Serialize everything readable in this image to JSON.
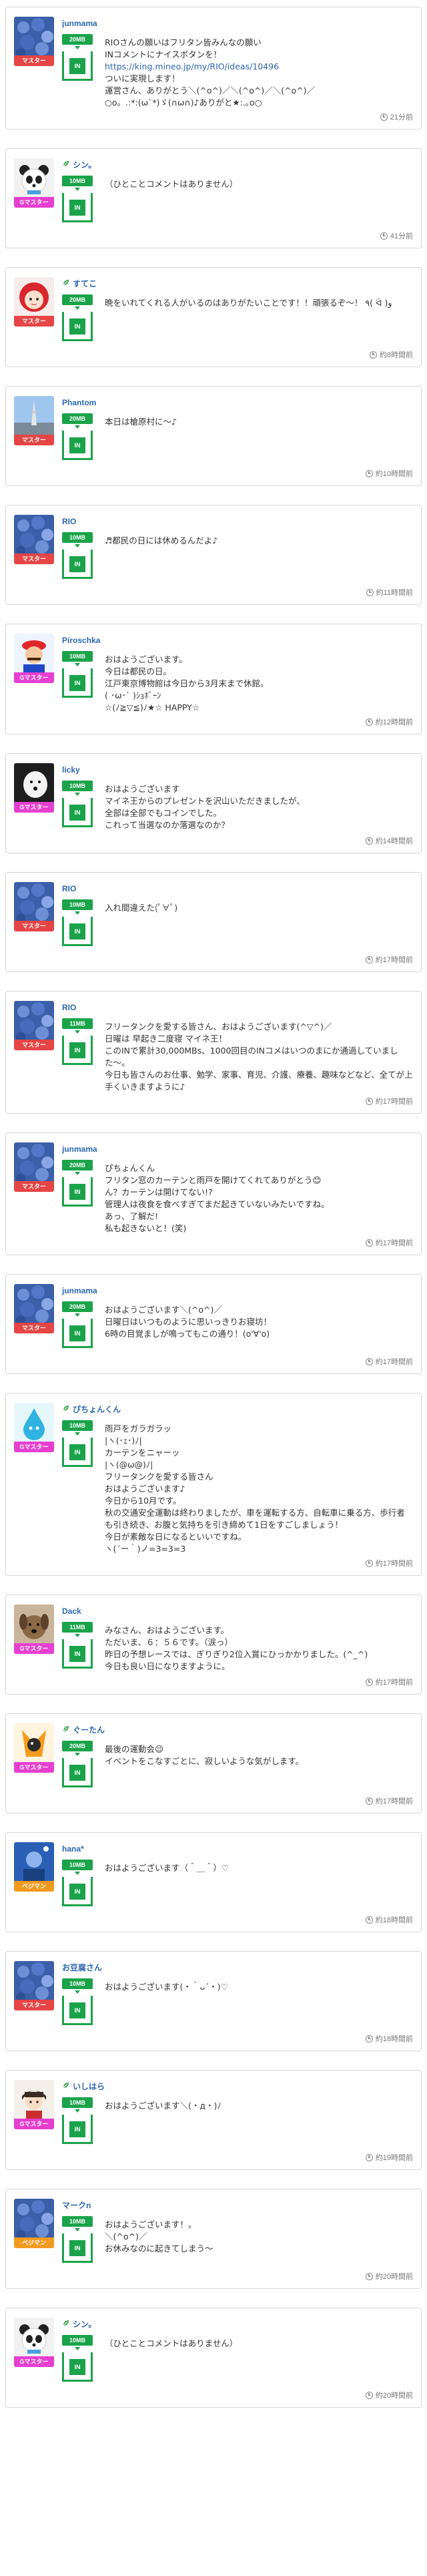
{
  "colors": {
    "plan_green": "#1aa34a",
    "master": "#e64545",
    "gmaster": "#e63fd0",
    "beginner": "#f29a1f",
    "name_blue": "#2e67b1"
  },
  "posts": [
    {
      "name": "junmama",
      "rank": "マスター",
      "rank_type": "master",
      "plan": "20MB",
      "icon": "",
      "avatar": "hydrangea-photo",
      "body": "RIOさんの願いはフリタン皆みんなの願い\nINコメントにナイスボタンを！",
      "link": "https://king.mineo.jp/my/RIO/ideas/10496",
      "body2": "ついに実現します！\n運営さん、ありがとう＼(^o^)／＼(^o^)／＼(^o^)／\n○o。.:*:(ω`*)ゞ(∩ω∩)♪ありがと★:.｡o○",
      "time": "21分前"
    },
    {
      "name": "シン。",
      "rank": "Gマスター",
      "rank_type": "gmaster",
      "plan": "10MB",
      "icon": "leaf-icon",
      "avatar": "panda-avatar",
      "body": "（ひとことコメントはありません）",
      "time": "41分前"
    },
    {
      "name": "すてこ",
      "rank": "マスター",
      "rank_type": "master",
      "plan": "20MB",
      "icon": "leaf-icon",
      "avatar": "red-hair-avatar",
      "body": "晩をいれてくれる人がいるのはありがたいことです！！頑張るぞ〜！ ٩( ᐛ )و",
      "time": "約8時間前"
    },
    {
      "name": "Phantom",
      "rank": "マスター",
      "rank_type": "master",
      "plan": "20MB",
      "icon": "",
      "avatar": "tower-photo",
      "body": "本日は槍原村に〜♪",
      "time": "約10時間前"
    },
    {
      "name": "RIO",
      "rank": "マスター",
      "rank_type": "master",
      "plan": "10MB",
      "icon": "",
      "avatar": "hydrangea-photo",
      "body": "♬都民の日には休めるんだよ♪",
      "time": "約11時間前"
    },
    {
      "name": "Piroschka",
      "rank": "Gマスター",
      "rank_type": "gmaster",
      "plan": "10MB",
      "icon": "",
      "avatar": "mario-avatar",
      "body": "おはようございます。\n今日は都民の日。\n江戸東京博物館は今日から3月末まで休館。\n( ･ω･` )ｼｮﾎﾞｰﾝ\n☆(ﾉ≧▽≦)ﾉ★☆ HAPPY☆",
      "time": "約12時間前"
    },
    {
      "name": "licky",
      "rank": "Gマスター",
      "rank_type": "gmaster",
      "plan": "10MB",
      "icon": "",
      "avatar": "white-dog-photo",
      "body": "おはようございます\nマイネ王からのプレゼントを沢山いただきましたが、\n全部は全部でもコインでした。\nこれって当選なのか落選なのか？",
      "time": "約14時間前"
    },
    {
      "name": "RIO",
      "rank": "マスター",
      "rank_type": "master",
      "plan": "10MB",
      "icon": "",
      "avatar": "hydrangea-photo",
      "body": "入れ間違えた(ﾟ∀ﾟ)",
      "time": "約17時間前"
    },
    {
      "name": "RIO",
      "rank": "マスター",
      "rank_type": "master",
      "plan": "11MB",
      "icon": "",
      "avatar": "hydrangea-photo",
      "body": "フリータンクを愛する皆さん、おはようございます(^▽^)／\n日曜は 早起き二度寝 マイネ王！\nこのINで累計30,000MBs、1000回目のINコメはいつのまにか通過していました〜。\n今日も皆さんのお仕事、勉学、家事、育児、介護、療養、趣味などなど、全てが上手くいきますように♪",
      "time": "約17時間前"
    },
    {
      "name": "junmama",
      "rank": "マスター",
      "rank_type": "master",
      "plan": "20MB",
      "icon": "",
      "avatar": "hydrangea-photo",
      "body": "ぴちょんくん\nフリタン窓のカーテンと雨戸を開けてくれてありがとう😊\nん？カーテンは開けてない!?\n管理人は夜食を食べすぎてまだ起きていないみたいですね。\nあっ、了解だ!\n私も起きないと！(笑)",
      "time": "約17時間前"
    },
    {
      "name": "junmama",
      "rank": "マスター",
      "rank_type": "master",
      "plan": "20MB",
      "icon": "",
      "avatar": "hydrangea-photo",
      "body": "おはようございます＼(^o^)／\n日曜日はいつものように思いっきりお寝坊！\n6時の目覚ましが鳴ってもこの通り！(o'∀'o)",
      "time": "約17時間前"
    },
    {
      "name": "ぴちょんくん",
      "rank": "Gマスター",
      "rank_type": "gmaster",
      "plan": "10MB",
      "icon": "leaf-icon",
      "avatar": "drop-avatar",
      "body": "雨戸をガラガラッ\n|ヽ(･ｪ･)ﾉ|\nカーテンをニャーッ\n|ヽ(@ω@)ﾉ|\nフリータンクを愛する皆さん\nおはようございます♪\n今日から10月です。\n秋の交通安全運動は終わりましたが、車を運転する方、自転車に乗る方、歩行者も引き続き、お腹と気持ちを引き締めて1日をすごしましょう！\n今日が素敵な日になるといいですね。\nヽ(´ー｀)ノ=3=3=3",
      "time": "約17時間前"
    },
    {
      "name": "Dack",
      "rank": "Gマスター",
      "rank_type": "gmaster",
      "plan": "11MB",
      "icon": "",
      "avatar": "dog-photo",
      "body": "みなさん、おはようございます。\nただいま、６：５６です。（涙っ）\n昨日の予想レースでは、ぎりぎり2位入賞にひっかかりました。(^_^)\n今日も良い日になりますように。",
      "time": "約17時間前"
    },
    {
      "name": "ぐーたん",
      "rank": "Gマスター",
      "rank_type": "gmaster",
      "plan": "20MB",
      "icon": "leaf-icon",
      "avatar": "game-avatar",
      "body": "最後の運動会😉\nイベントをこなすごとに、寂しいような気がします。",
      "time": "約17時間前"
    },
    {
      "name": "hana*",
      "rank": "ベジマン",
      "rank_type": "beginner",
      "plan": "10MB",
      "icon": "",
      "avatar": "blue-avatar",
      "body": "おはようございます（＾＿＾）♡",
      "time": "約18時間前"
    },
    {
      "name": "お豆腐さん",
      "rank": "マスター",
      "rank_type": "master",
      "plan": "10MB",
      "icon": "",
      "avatar": "hydrangea-photo",
      "body": "おはようございます(・｀ᴗ´・)♡",
      "time": "約18時間前"
    },
    {
      "name": "いしはら",
      "rank": "Gマスター",
      "rank_type": "gmaster",
      "plan": "10MB",
      "icon": "leaf-icon",
      "avatar": "anime-boy-avatar",
      "body": "おはようございます＼(・д・)ﾉ",
      "time": "約19時間前"
    },
    {
      "name": "マークn",
      "rank": "ベジマン",
      "rank_type": "beginner",
      "plan": "10MB",
      "icon": "",
      "avatar": "hydrangea-photo",
      "body": "おはようございます！。\n＼(^o^)／\nお休みなのに起きてしまう〜",
      "time": "約20時間前"
    },
    {
      "name": "シン。",
      "rank": "Gマスター",
      "rank_type": "gmaster",
      "plan": "10MB",
      "icon": "leaf-icon",
      "avatar": "panda-avatar",
      "body": "（ひとことコメントはありません）",
      "time": "約20時間前"
    }
  ]
}
